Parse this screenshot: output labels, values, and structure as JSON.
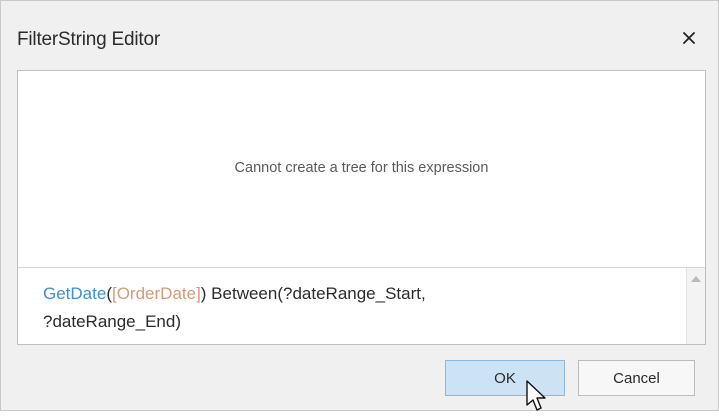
{
  "window": {
    "title": "FilterString Editor"
  },
  "tree": {
    "message": "Cannot create a tree for this expression"
  },
  "expression": {
    "fn1": "GetDate",
    "paren_open": "(",
    "field": "[OrderDate]",
    "rest_line1": ") Between(?dateRange_Start,",
    "line2": "?dateRange_End)"
  },
  "buttons": {
    "ok": "OK",
    "cancel": "Cancel"
  },
  "icons": {
    "close": "close-icon",
    "scroll_up": "scroll-up-arrow-icon",
    "cursor": "mouse-pointer-icon"
  }
}
